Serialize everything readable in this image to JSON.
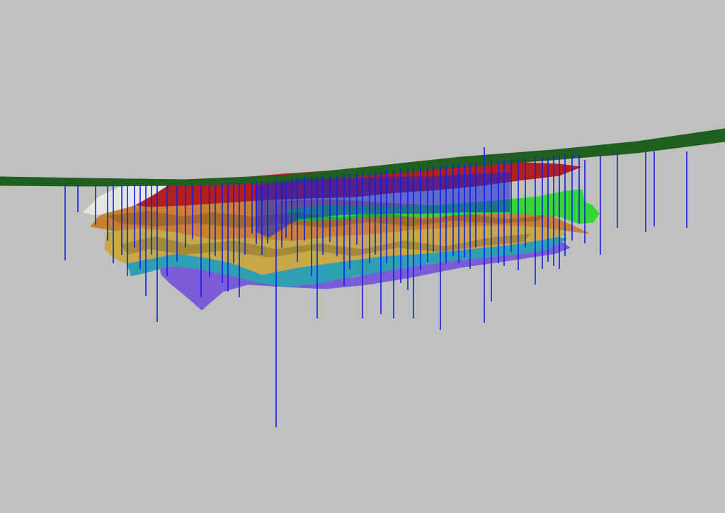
{
  "scene": {
    "background_color": "#c0c0c0",
    "layers": [
      {
        "name": "topographic-surface",
        "color": "#1f5f1f"
      },
      {
        "name": "red-horizon",
        "color": "#b02020"
      },
      {
        "name": "white-horizon",
        "color": "#e6e6e6"
      },
      {
        "name": "orange-horizon",
        "color": "#c98035"
      },
      {
        "name": "green-body",
        "color": "#33d633"
      },
      {
        "name": "tan-horizon",
        "color": "#c8a848"
      },
      {
        "name": "teal-horizon",
        "color": "#2f9fb5"
      },
      {
        "name": "purple-horizon",
        "color": "#7a5cd6"
      }
    ],
    "boreholes": {
      "color": "#1020e0"
    }
  }
}
